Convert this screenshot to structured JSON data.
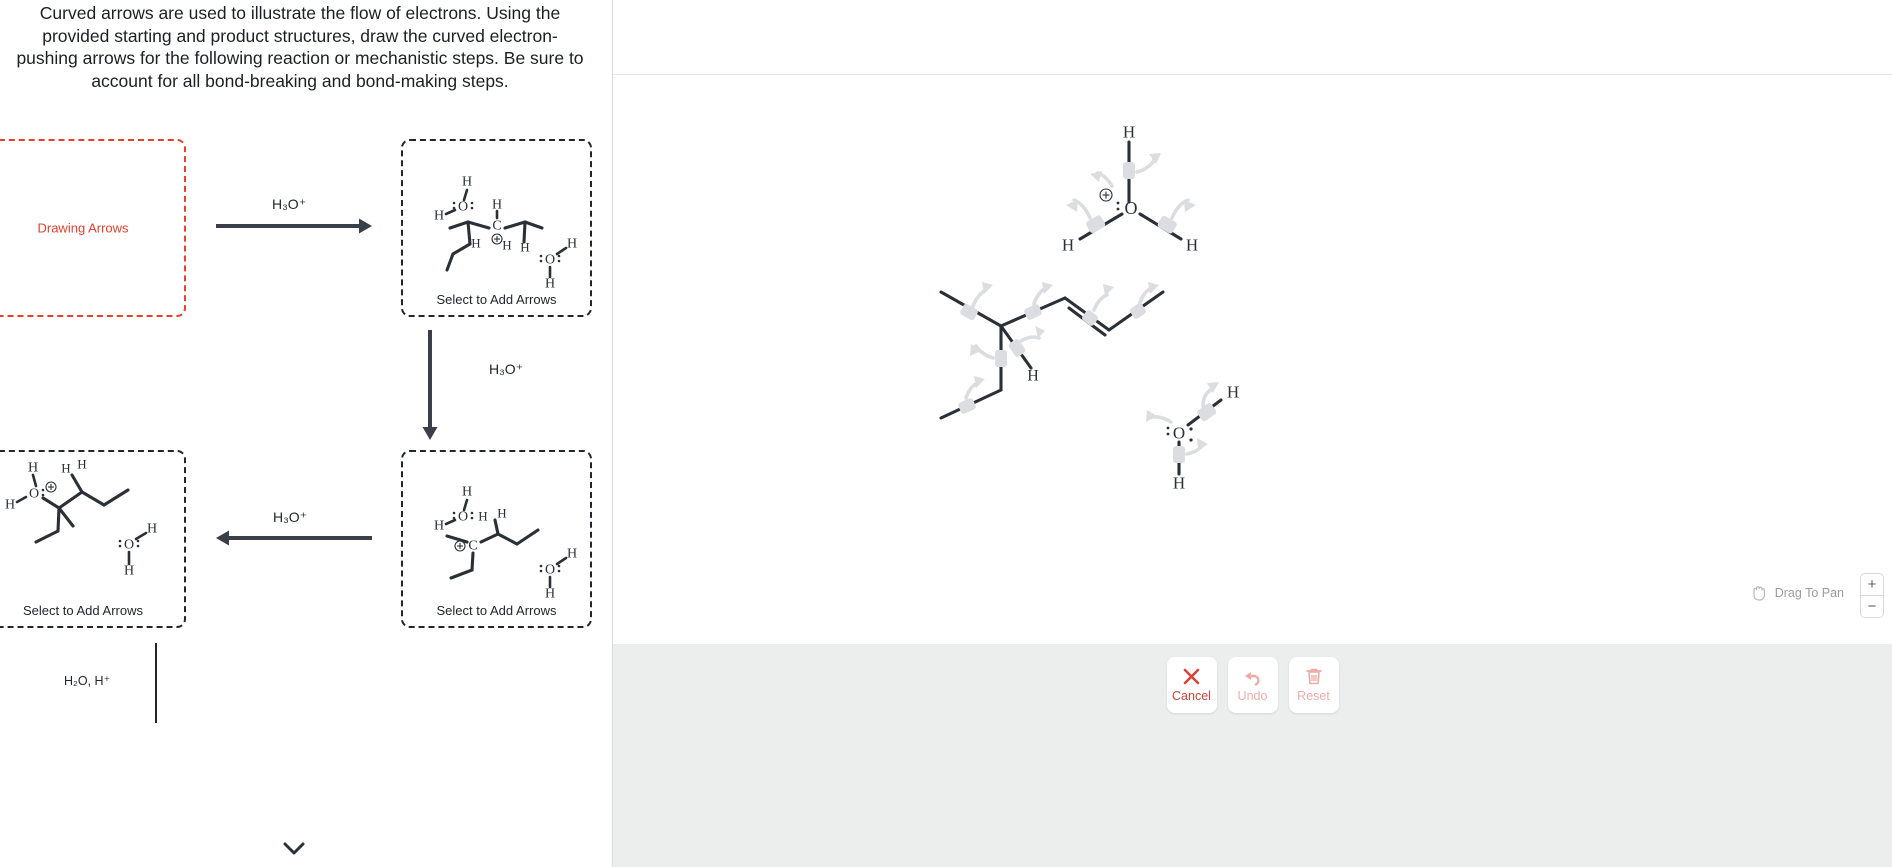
{
  "prompt": {
    "text": "Curved arrows are used to illustrate the flow of electrons. Using the provided starting and product structures, draw the curved electron-pushing arrows for the following reaction or mechanistic steps. Be sure to account for all bond-breaking and bond-making steps."
  },
  "scheme": {
    "step1_placeholder": "Drawing Arrows",
    "box2_caption": "Select to Add Arrows",
    "box3_caption": "Select to Add Arrows",
    "box4_caption": "Select to Add Arrows",
    "arrow1_label": "H₃O⁺",
    "arrow2_label": "H₃O⁺",
    "arrow3_label": "H₃O⁺",
    "next_step_label": "H₂O, H⁺"
  },
  "toolbar": {
    "cancel_label": "Cancel",
    "undo_label": "Undo",
    "reset_label": "Reset"
  },
  "canvas": {
    "pan_hint": "Drag To Pan",
    "zoom_in_label": "+",
    "zoom_out_label": "−"
  },
  "colors": {
    "accent_red": "#e8402a",
    "button_red": "#d3453a",
    "button_red_disabled": "#eeaca6",
    "ink": "#2b3038",
    "handle_gray": "#dcdde0",
    "toolbar_bg": "#eceded"
  },
  "atoms": {
    "H": "H",
    "O": "O",
    "C": "C"
  }
}
